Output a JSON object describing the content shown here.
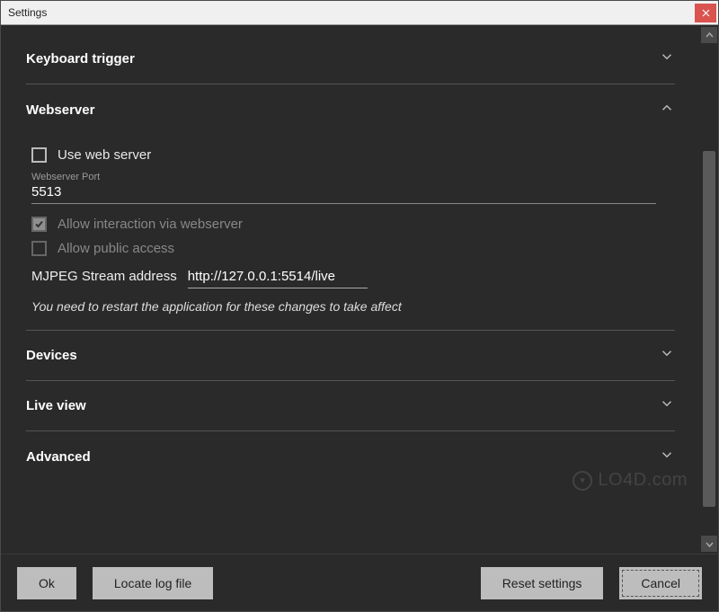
{
  "window": {
    "title": "Settings"
  },
  "sections": {
    "keyboard_trigger": {
      "label": "Keyboard trigger",
      "expanded": false
    },
    "webserver": {
      "label": "Webserver",
      "expanded": true,
      "use_web_server_label": "Use web server",
      "use_web_server_checked": false,
      "port_label": "Webserver Port",
      "port_value": "5513",
      "allow_interaction_label": "Allow interaction via webserver",
      "allow_interaction_checked": true,
      "allow_public_label": "Allow public access",
      "allow_public_checked": false,
      "stream_label": "MJPEG Stream address",
      "stream_value": "http://127.0.0.1:5514/live",
      "restart_note": "You need to restart the application for these changes to take affect"
    },
    "devices": {
      "label": "Devices",
      "expanded": false
    },
    "live_view": {
      "label": "Live view",
      "expanded": false
    },
    "advanced": {
      "label": "Advanced",
      "expanded": false
    }
  },
  "footer": {
    "ok": "Ok",
    "locate_log": "Locate log file",
    "reset": "Reset settings",
    "cancel": "Cancel"
  },
  "watermark": "LO4D.com"
}
